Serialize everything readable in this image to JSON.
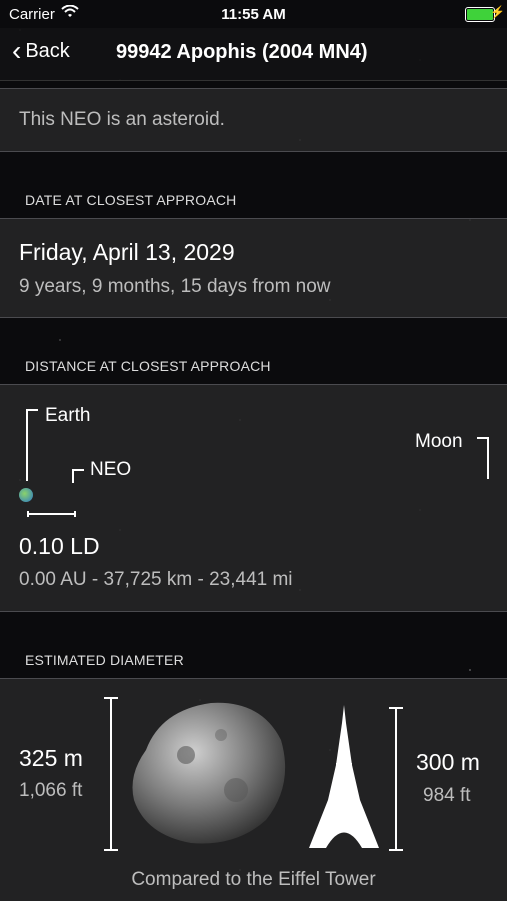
{
  "status_bar": {
    "carrier": "Carrier",
    "time": "11:55 AM"
  },
  "nav": {
    "back_label": "Back",
    "title": "99942 Apophis (2004 MN4)"
  },
  "intro": {
    "text": "This NEO is an asteroid."
  },
  "approach_date": {
    "header": "DATE AT CLOSEST APPROACH",
    "date": "Friday, April 13, 2029",
    "relative": "9 years, 9 months, 15 days from now"
  },
  "approach_distance": {
    "header": "DISTANCE AT CLOSEST APPROACH",
    "earth_label": "Earth",
    "neo_label": "NEO",
    "moon_label": "Moon",
    "distance_ld": "0.10 LD",
    "distance_details": "0.00 AU - 37,725 km - 23,441 mi"
  },
  "diameter": {
    "header": "ESTIMATED DIAMETER",
    "asteroid_m": "325 m",
    "asteroid_ft": "1,066 ft",
    "tower_m": "300 m",
    "tower_ft": "984 ft",
    "caption": "Compared to the Eiffel Tower"
  },
  "colors": {
    "battery": "#3fd23a",
    "background": "#0b0b0d"
  }
}
